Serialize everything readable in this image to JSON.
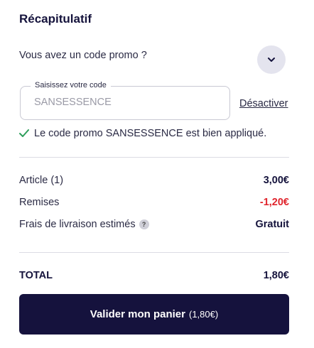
{
  "summary": {
    "title": "Récapitulatif",
    "promo_question": "Vous avez un code promo ?",
    "promo_field": {
      "label": "Saisissez votre code",
      "value": "SANSESSENCE"
    },
    "deactivate_label": "Désactiver",
    "success_message": "Le code promo SANSESSENCE est bien appliqué.",
    "lines": [
      {
        "label": "Article (1)",
        "value": "3,00€"
      },
      {
        "label": "Remises",
        "value": "-1,20€"
      },
      {
        "label": "Frais de livraison estimés",
        "value": "Gratuit",
        "help_icon": "?"
      }
    ],
    "total": {
      "label": "TOTAL",
      "value": "1,80€"
    },
    "cta": {
      "label": "Valider mon panier",
      "amount": "(1,80€)"
    },
    "colors": {
      "accent": "#15123d",
      "discount": "#e0242c",
      "success": "#2e9e5b"
    }
  }
}
